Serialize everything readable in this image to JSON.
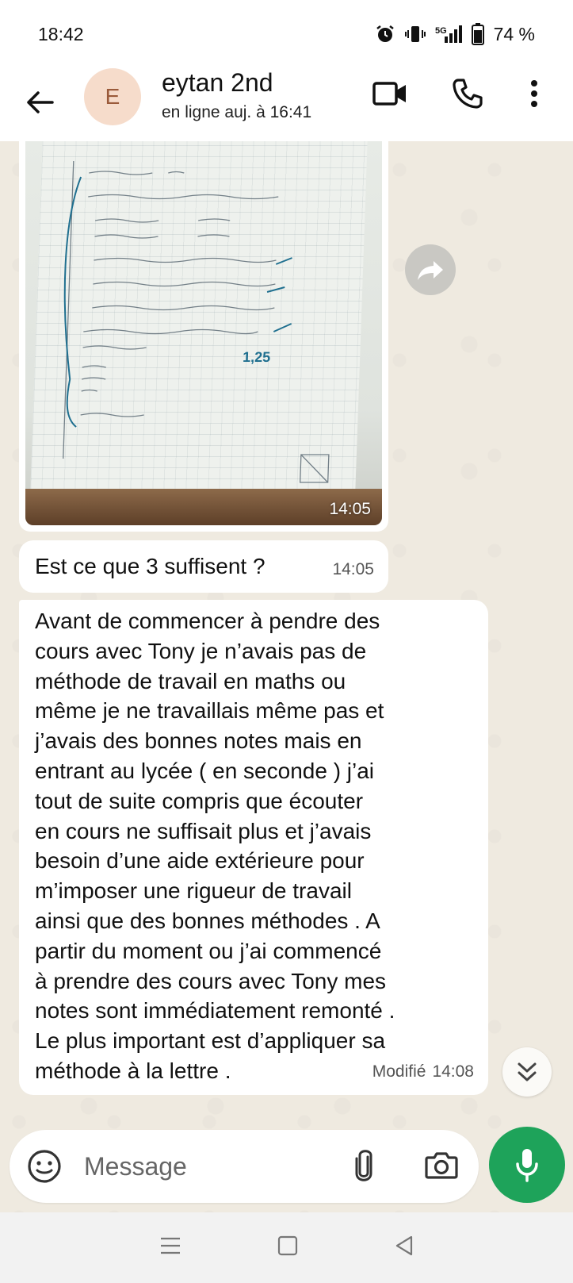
{
  "status_bar": {
    "time": "18:42",
    "network": "5G",
    "battery": "74 %",
    "icons": [
      "alarm-icon",
      "vibrate-icon",
      "signal-icon",
      "battery-icon"
    ]
  },
  "header": {
    "avatar_letter": "E",
    "contact_name": "eytan 2nd",
    "contact_status": "en ligne auj. à 16:41",
    "icons": [
      "back-arrow-icon",
      "video-call-icon",
      "phone-icon",
      "more-vert-icon"
    ]
  },
  "messages": [
    {
      "type": "image",
      "time": "14:05",
      "handwriting": [
        "1,25"
      ]
    },
    {
      "type": "text",
      "text": "Est ce que 3 suffisent ?",
      "time": "14:05"
    },
    {
      "type": "text",
      "text": "Avant de commencer à pendre des\ncours avec Tony je n’avais pas de\nméthode de travail en maths ou\nmême je ne travaillais même pas et\nj’avais des bonnes notes mais en\nentrant au lycée ( en seconde ) j’ai\ntout de suite compris que écouter\nen cours ne suffisait plus et j’avais\nbesoin d’une aide extérieure pour\nm’imposer une rigueur de travail\nainsi que des bonnes méthodes . A\npartir du moment ou j’ai commencé\nà prendre des cours avec Tony mes\nnotes sont immédiatement remonté .\nLe plus important est d’appliquer sa\nméthode à la lettre .",
      "edited_label": "Modifié",
      "time": "14:08"
    }
  ],
  "composer": {
    "placeholder": "Message"
  },
  "colors": {
    "accent": "#1ea35a",
    "chat_background": "#efeae0",
    "bubble": "#ffffff"
  }
}
